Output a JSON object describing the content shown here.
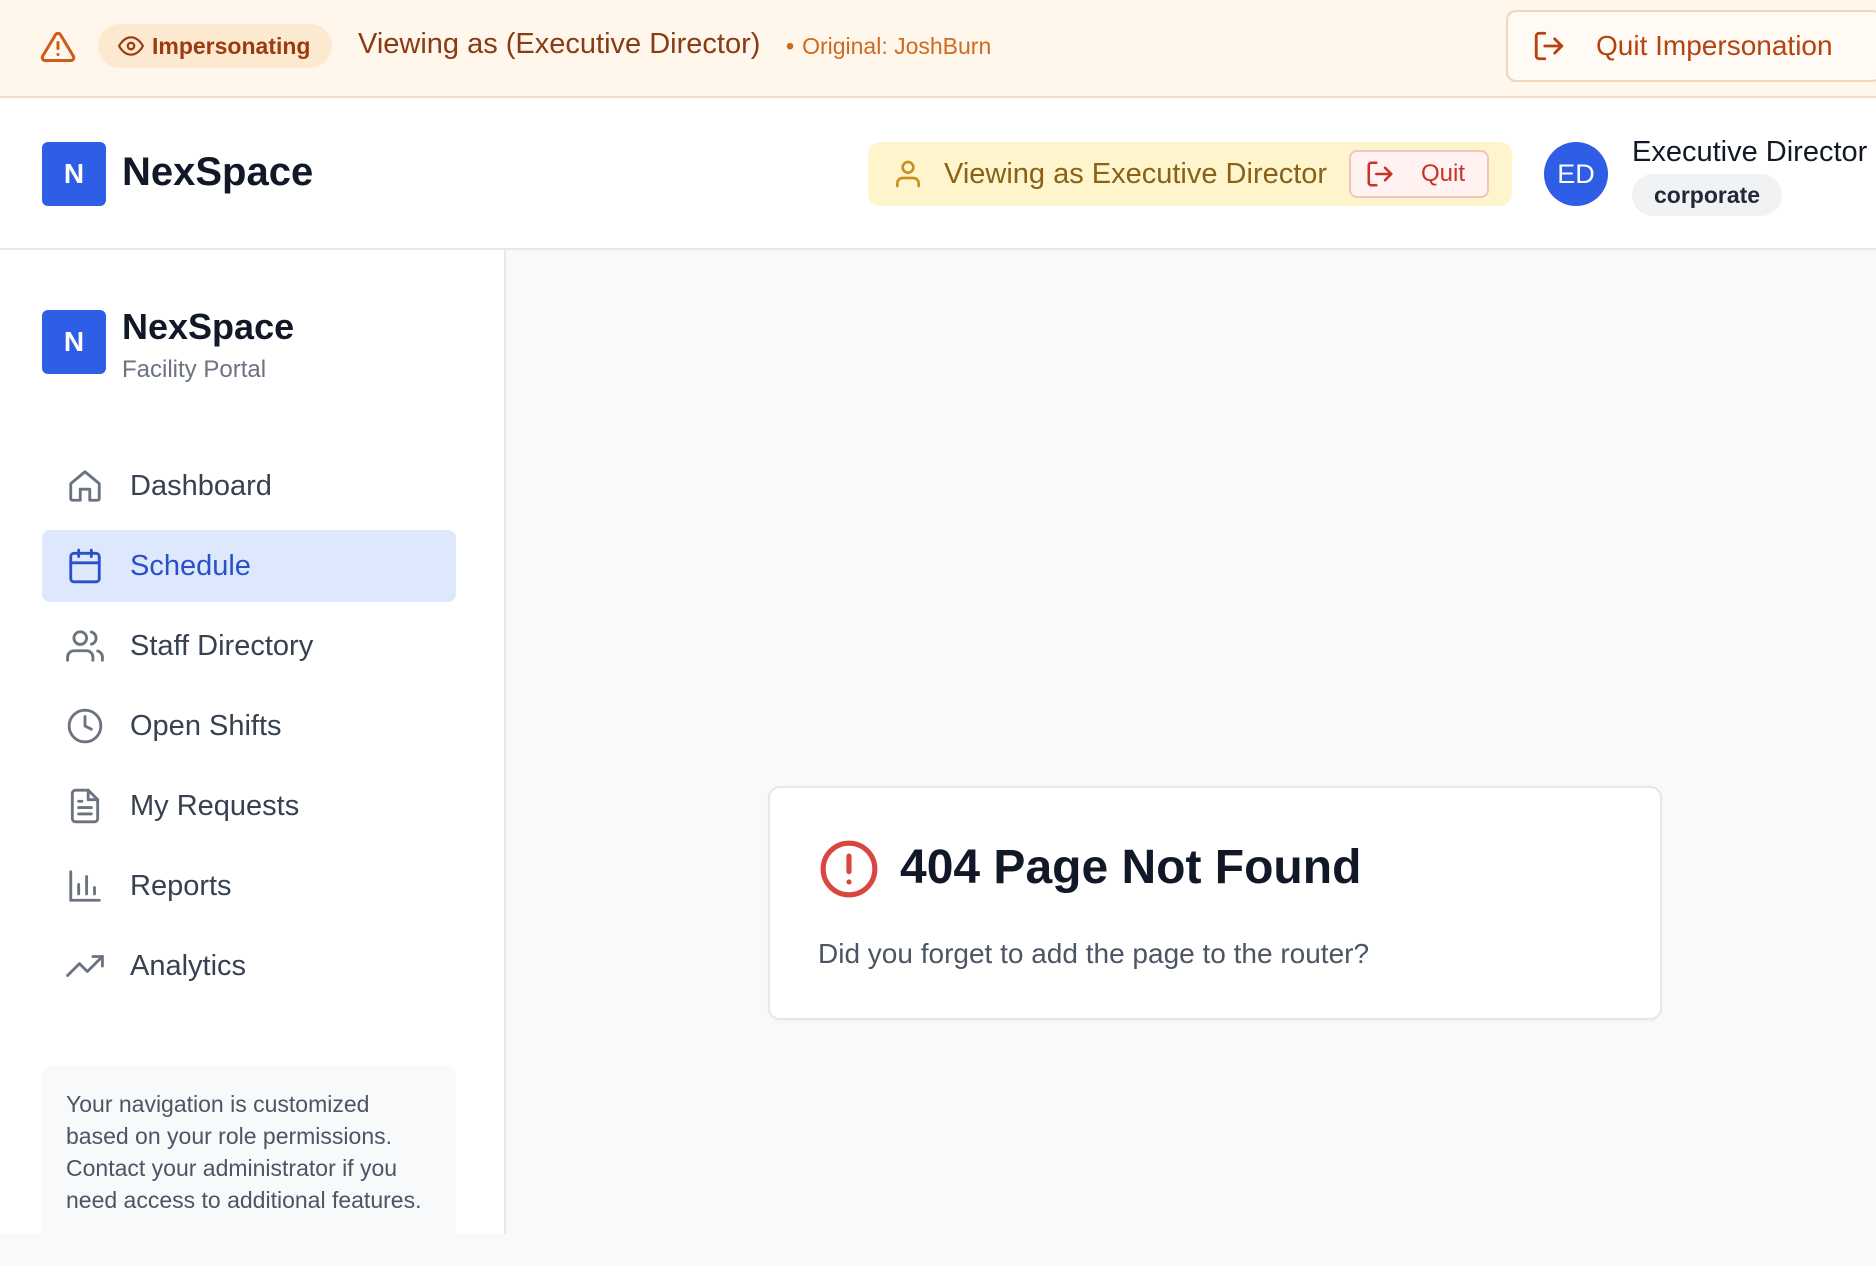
{
  "impersonation_bar": {
    "badge": "Impersonating",
    "viewing_text": "Viewing as (Executive Director)",
    "original_text": "Original: JoshBurn",
    "quit_button": "Quit Impersonation",
    "colors": {
      "background": "#fff6ec",
      "accent": "#b4430f"
    }
  },
  "header": {
    "logo_letter": "N",
    "brand": "NexSpace",
    "viewing_as": "Viewing as Executive Director",
    "quit_label": "Quit",
    "avatar_initials": "ED",
    "user_name": "Executive Director",
    "user_role": "corporate"
  },
  "sidebar": {
    "logo_letter": "N",
    "brand": "NexSpace",
    "subtitle": "Facility Portal",
    "items": [
      {
        "label": "Dashboard",
        "icon": "home-icon",
        "active": false
      },
      {
        "label": "Schedule",
        "icon": "calendar-icon",
        "active": true
      },
      {
        "label": "Staff Directory",
        "icon": "users-icon",
        "active": false
      },
      {
        "label": "Open Shifts",
        "icon": "clock-icon",
        "active": false
      },
      {
        "label": "My Requests",
        "icon": "file-text-icon",
        "active": false
      },
      {
        "label": "Reports",
        "icon": "bar-chart-icon",
        "active": false
      },
      {
        "label": "Analytics",
        "icon": "trending-up-icon",
        "active": false
      }
    ],
    "note": "Your navigation is customized based on your role permissions. Contact your administrator if you need access to additional features."
  },
  "main": {
    "error_title": "404 Page Not Found",
    "error_message": "Did you forget to add the page to the router?"
  },
  "colors": {
    "brand": "#2e5ee6",
    "active_nav_bg": "#dde8fd",
    "error": "#d9463f"
  }
}
